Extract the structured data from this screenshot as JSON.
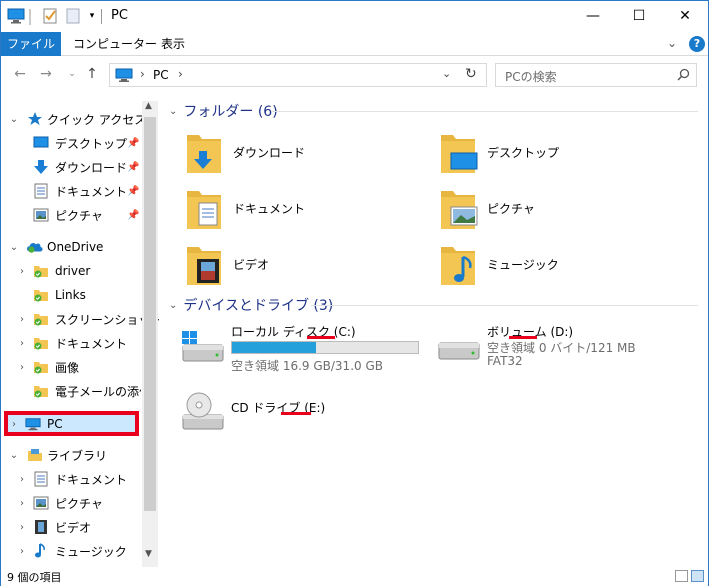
{
  "window": {
    "title": "PC",
    "minimize": "—",
    "maximize": "☐",
    "close": "✕"
  },
  "ribbon": {
    "tabs": [
      "ファイル",
      "コンピューター",
      "表示"
    ],
    "collapse": "⌄",
    "help": "?"
  },
  "address": {
    "location": "PC",
    "search_placeholder": "PCの検索"
  },
  "nav": {
    "quick_access": "クイック アクセス",
    "quick_items": [
      "デスクトップ",
      "ダウンロード",
      "ドキュメント",
      "ピクチャ"
    ],
    "onedrive": "OneDrive",
    "onedrive_items": [
      "driver",
      "Links",
      "スクリーンショット",
      "ドキュメント",
      "画像",
      "電子メールの添付"
    ],
    "pc": "PC",
    "library": "ライブラリ",
    "library_items": [
      "ドキュメント",
      "ピクチャ",
      "ビデオ",
      "ミュージック"
    ]
  },
  "folders_group": {
    "title": "フォルダー (6)",
    "items": [
      "ダウンロード",
      "デスクトップ",
      "ドキュメント",
      "ピクチャ",
      "ビデオ",
      "ミュージック"
    ]
  },
  "devices_group": {
    "title": "デバイスとドライブ (3)"
  },
  "drives": [
    {
      "name": "ローカル ディスク (C:)",
      "free": "空き領域 16.9 GB/31.0 GB",
      "used_fraction": 0.45
    },
    {
      "name": "ボリューム (D:)",
      "free": "空き領域 0 バイト/121 MB",
      "fs": "FAT32"
    },
    {
      "name": "CD ドライブ (E:)"
    }
  ],
  "status": {
    "text": "9 個の項目"
  },
  "colors": {
    "accent": "#1979ca",
    "highlight": "#e8001c",
    "selection": "#cce8ff",
    "group_header": "#1e3287",
    "folder": "#f3c654",
    "drive_bar": "#26a0da"
  }
}
